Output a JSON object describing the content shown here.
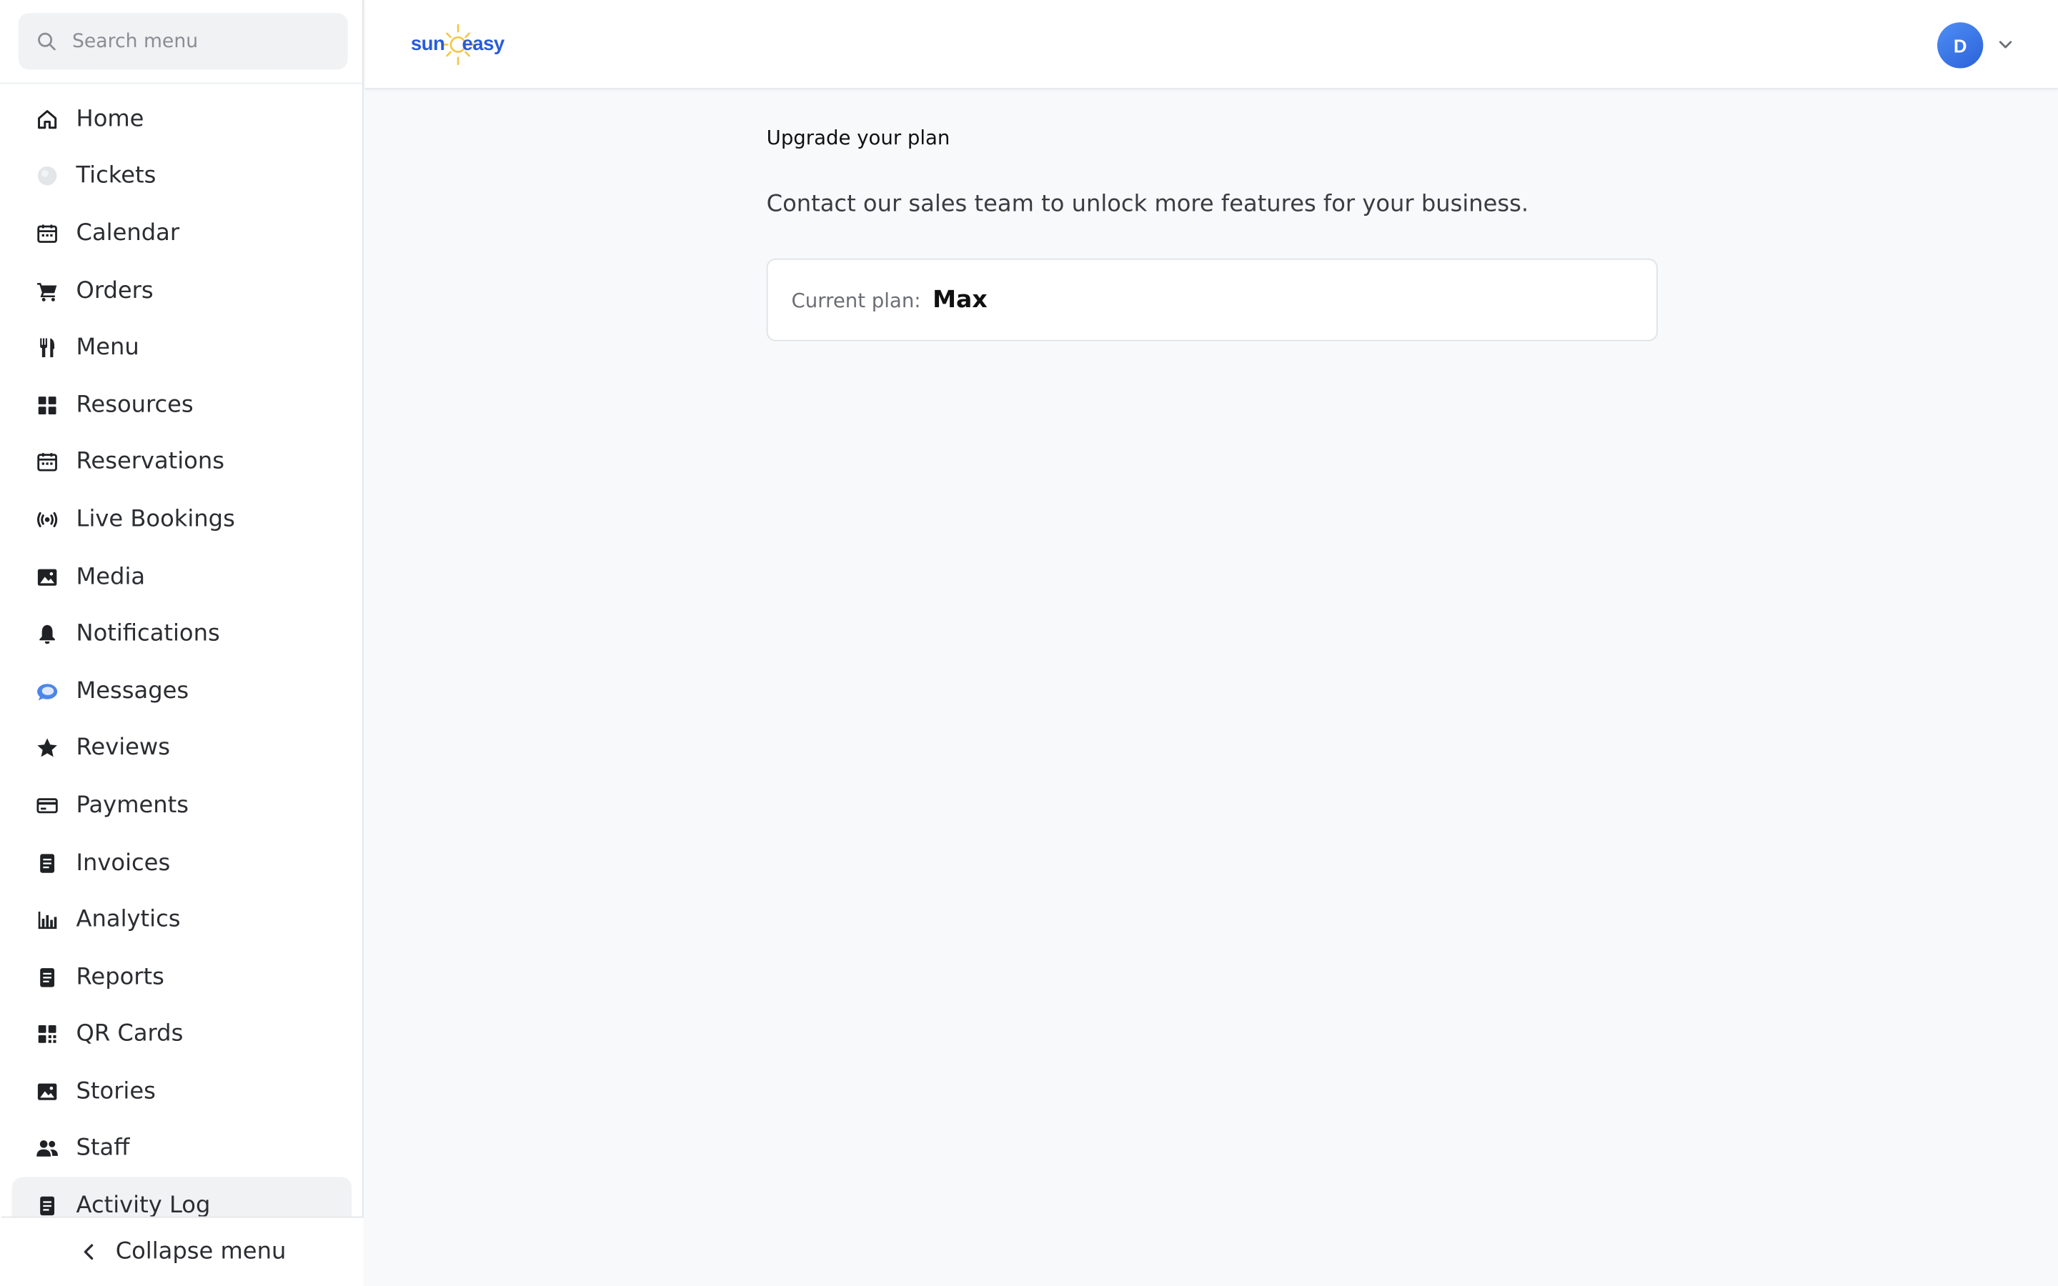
{
  "search": {
    "placeholder": "Search menu"
  },
  "sidebar": {
    "items": [
      {
        "label": "Home",
        "icon": "home-icon"
      },
      {
        "label": "Tickets",
        "icon": "tickets-icon"
      },
      {
        "label": "Calendar",
        "icon": "calendar-icon"
      },
      {
        "label": "Orders",
        "icon": "cart-icon"
      },
      {
        "label": "Menu",
        "icon": "utensils-icon"
      },
      {
        "label": "Resources",
        "icon": "grid-icon"
      },
      {
        "label": "Reservations",
        "icon": "calendar-icon"
      },
      {
        "label": "Live Bookings",
        "icon": "broadcast-icon"
      },
      {
        "label": "Media",
        "icon": "image-icon"
      },
      {
        "label": "Notifications",
        "icon": "bell-icon"
      },
      {
        "label": "Messages",
        "icon": "chat-icon"
      },
      {
        "label": "Reviews",
        "icon": "star-icon"
      },
      {
        "label": "Payments",
        "icon": "credit-card-icon"
      },
      {
        "label": "Invoices",
        "icon": "document-icon"
      },
      {
        "label": "Analytics",
        "icon": "bar-chart-icon"
      },
      {
        "label": "Reports",
        "icon": "document-icon"
      },
      {
        "label": "QR Cards",
        "icon": "qr-code-icon"
      },
      {
        "label": "Stories",
        "icon": "image-icon"
      },
      {
        "label": "Staff",
        "icon": "people-icon"
      },
      {
        "label": "Activity Log",
        "icon": "document-icon"
      }
    ],
    "collapse_label": "Collapse menu"
  },
  "header": {
    "logo_left": "sun",
    "logo_right": "easy",
    "avatar_initial": "D"
  },
  "main": {
    "title": "Upgrade your plan",
    "subtitle": "Contact our sales team to unlock more features for your business.",
    "plan_label": "Current plan:",
    "plan_value": "Max"
  },
  "colors": {
    "accent": "#2a5bd7",
    "avatar": "#3b7bea",
    "page_background": "#f8f9fb",
    "sun": "#f5c542"
  }
}
